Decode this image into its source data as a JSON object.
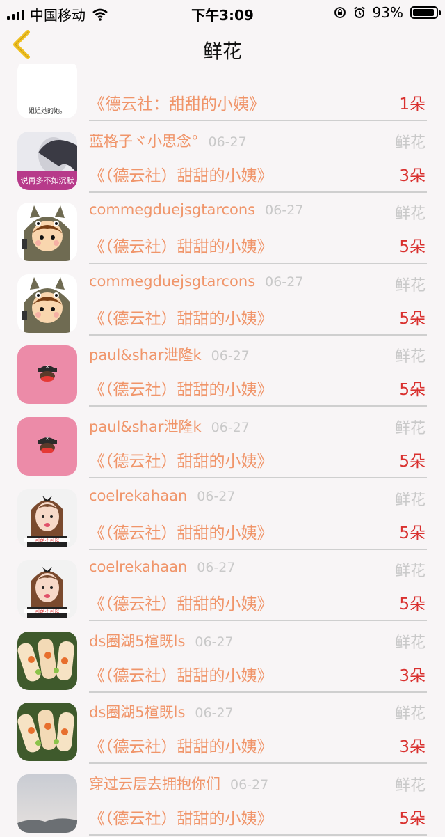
{
  "status": {
    "carrier": "中国移动",
    "time": "下午3:09",
    "battery": "93%",
    "battery_level": 0.93
  },
  "nav": {
    "title": "鲜花",
    "back_icon": "chevron-left-icon",
    "accent": "#f0c020"
  },
  "colors": {
    "name": "#f0956a",
    "count": "#d9302e",
    "muted": "#c9c9c9"
  },
  "rows": [
    {
      "name": "",
      "date": "",
      "gift": "",
      "song": "《德云社：甜甜的小姨》",
      "count": "1朵",
      "avatar": "avatar-text-icon",
      "avatar_text": "姐姐她的她。"
    },
    {
      "name": "蓝格子ヾ小思念°",
      "date": "06-27",
      "gift": "鲜花",
      "song": "《（德云社）甜甜的小姨》",
      "count": "3朵",
      "avatar": "avatar-photo-icon",
      "avatar_text": "说再多不如沉默"
    },
    {
      "name": "commegduejsgtarcons",
      "date": "06-27",
      "gift": "鲜花",
      "song": "《（德云社）甜甜的小姨》",
      "count": "5朵",
      "avatar": "avatar-totoro-icon"
    },
    {
      "name": "commegduejsgtarcons",
      "date": "06-27",
      "gift": "鲜花",
      "song": "《（德云社）甜甜的小姨》",
      "count": "5朵",
      "avatar": "avatar-totoro-icon"
    },
    {
      "name": "paul&shar泄隆k",
      "date": "06-27",
      "gift": "鲜花",
      "song": "《（德云社）甜甜的小姨》",
      "count": "5朵",
      "avatar": "avatar-pirate-monkey-icon"
    },
    {
      "name": "paul&shar泄隆k",
      "date": "06-27",
      "gift": "鲜花",
      "song": "《（德云社）甜甜的小姨》",
      "count": "5朵",
      "avatar": "avatar-pirate-monkey-icon"
    },
    {
      "name": "coelrekahaan",
      "date": "06-27",
      "gift": "鲜花",
      "song": "《（德云社）甜甜的小姨》",
      "count": "5朵",
      "avatar": "avatar-girl-icon"
    },
    {
      "name": "coelrekahaan",
      "date": "06-27",
      "gift": "鲜花",
      "song": "《（德云社）甜甜的小姨》",
      "count": "5朵",
      "avatar": "avatar-girl-icon"
    },
    {
      "name": "ds圈湖5楦既ls",
      "date": "06-27",
      "gift": "鲜花",
      "song": "《（德云社）甜甜的小姨》",
      "count": "3朵",
      "avatar": "avatar-food-icon"
    },
    {
      "name": "ds圈湖5楦既ls",
      "date": "06-27",
      "gift": "鲜花",
      "song": "《（德云社）甜甜的小姨》",
      "count": "3朵",
      "avatar": "avatar-food-icon"
    },
    {
      "name": "穿过云层去拥抱你们",
      "date": "06-27",
      "gift": "鲜花",
      "song": "《（德云社）甜甜的小姨》",
      "count": "5朵",
      "avatar": "avatar-sky-icon"
    }
  ]
}
